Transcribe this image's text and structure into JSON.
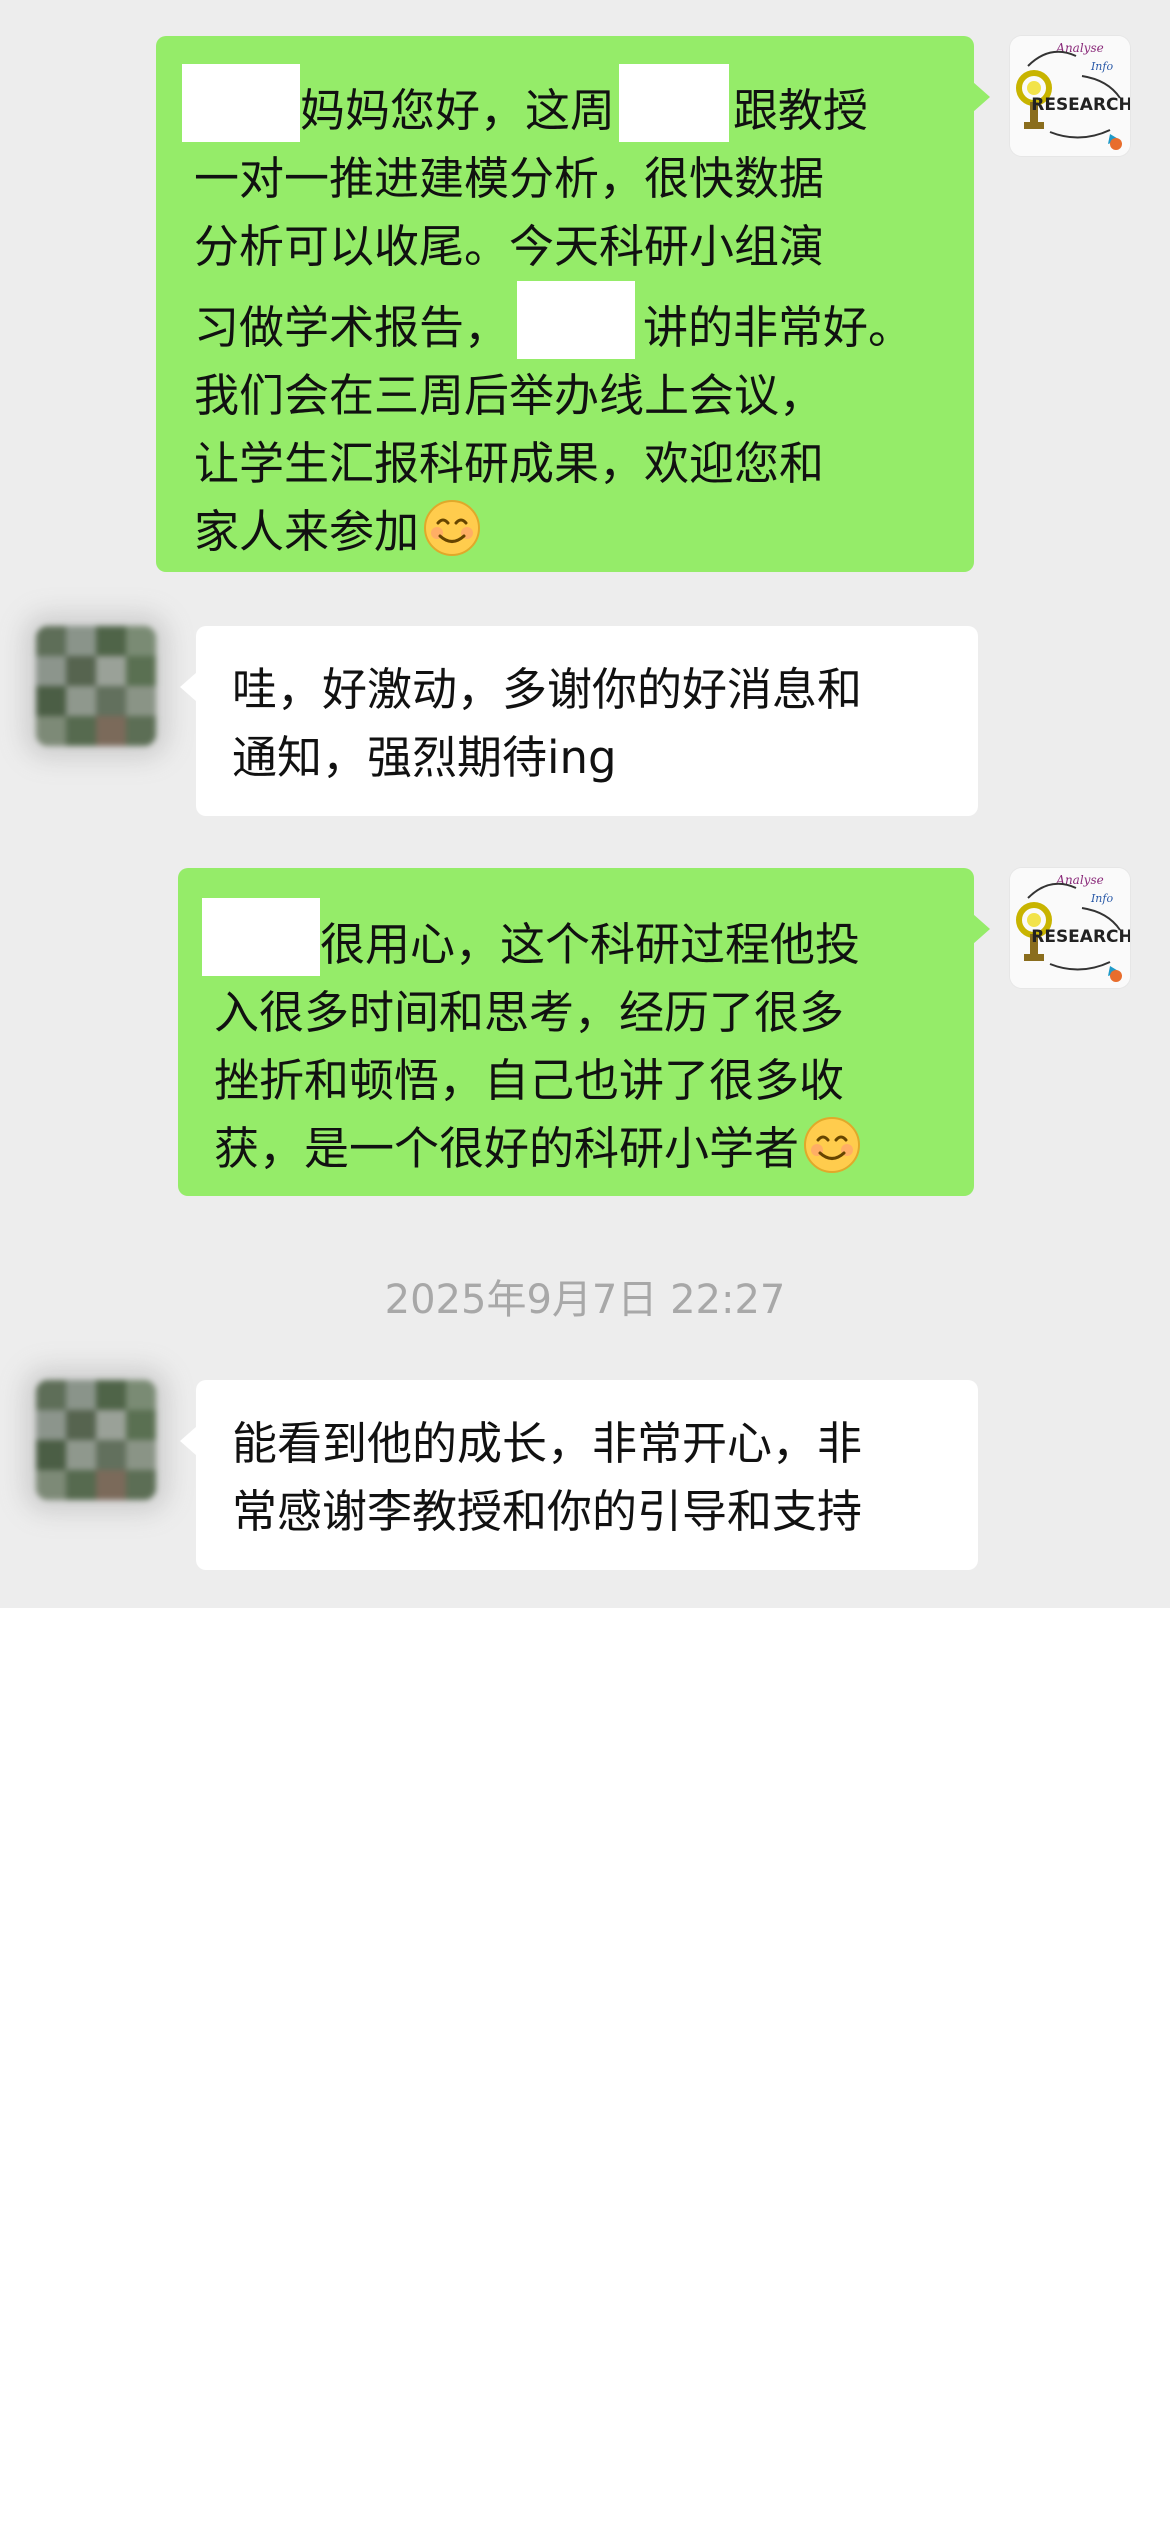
{
  "messages": [
    {
      "sender": "self",
      "avatar": "research-avatar",
      "lines": [
        {
          "a": "妈妈您好，这周",
          "b": "跟教授"
        },
        {
          "a": "一对一推进建模分析，很快数据"
        },
        {
          "a": "分析可以收尾。今天科研小组演"
        },
        {
          "a": "习做学术报告，",
          "b": "讲的非常好。"
        },
        {
          "a": "我们会在三周后举办线上会议，"
        },
        {
          "a": "让学生汇报科研成果，欢迎您和"
        },
        {
          "a": "家人来参加"
        }
      ]
    },
    {
      "sender": "other",
      "avatar": "blurred-avatar",
      "lines": [
        {
          "a": "哇，好激动，多谢你的好消息和"
        },
        {
          "a": "通知，强烈期待ing"
        }
      ]
    },
    {
      "sender": "self",
      "avatar": "research-avatar",
      "lines": [
        {
          "a": "很用心，这个科研过程他投"
        },
        {
          "a": "入很多时间和思考，经历了很多"
        },
        {
          "a": "挫折和顿悟，自己也讲了很多收"
        },
        {
          "a": "获，是一个很好的科研小学者"
        }
      ]
    },
    {
      "sender": "other",
      "avatar": "blurred-avatar",
      "lines": [
        {
          "a": "能看到他的成长，非常开心，非"
        },
        {
          "a": "常感谢李教授和你的引导和支持"
        }
      ]
    }
  ],
  "timestamp": "2025年9月7日 22:27",
  "research_logo": {
    "word": "RESEARCH",
    "tag1": "Analyse",
    "tag2": "Info"
  },
  "colors": {
    "chat_background": "#ededed",
    "self_bubble": "#95ec69",
    "other_bubble": "#ffffff",
    "timestamp_text": "#a8a8a8",
    "emoji_face": "#ffcc4d"
  },
  "emoji": "smiling-face-emoji"
}
